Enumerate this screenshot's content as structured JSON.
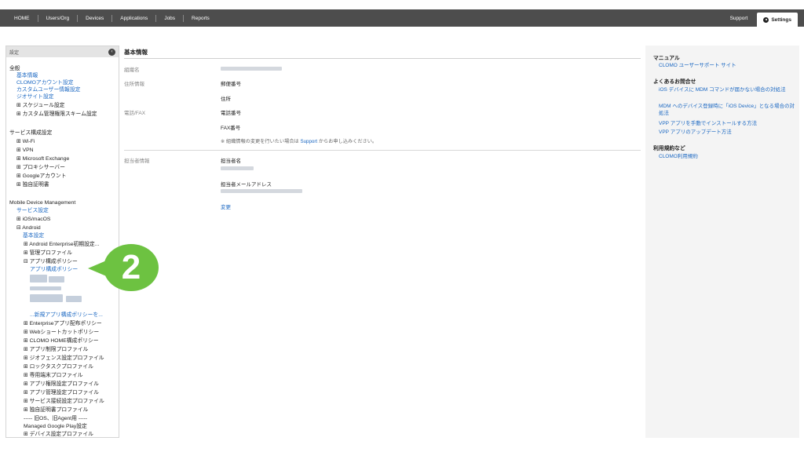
{
  "topnav": {
    "items": [
      "HOME",
      "Users/Org",
      "Devices",
      "Applications",
      "Jobs",
      "Reports"
    ],
    "support": "Support",
    "settings": "Settings"
  },
  "sidebar": {
    "header": "設定",
    "general_heading": "全般",
    "general_links": [
      "基本情報",
      "CLOMOアカウント設定",
      "カスタムユーザー情報設定",
      "ジオサイト設定"
    ],
    "general_trees": [
      "⊞ スケジュール設定",
      "⊞ カスタム管理権限スキーム設定"
    ],
    "service_heading": "サービス構成設定",
    "service_items": [
      "⊞ Wi-Fi",
      "⊞ VPN",
      "⊞ Microsoft Exchange",
      "⊞ プロキシサーバー",
      "⊞ Googleアカウント",
      "⊞ 独自証明書"
    ],
    "mdm_heading": "Mobile Device Management",
    "mdm_service_link": "サービス設定",
    "mdm_ios": "⊞ iOS/macOS",
    "mdm_android": "⊟ Android",
    "android_basic_link": "基本設定",
    "android_enterprise": "⊞ Android Enterprise初期設定...",
    "android_mgmt_profile": "⊞ 管理プロファイル",
    "app_config_tree": "⊟ アプリ構成ポリシー",
    "app_config_link": "アプリ構成ポリシー",
    "new_policy_link": "...新規アプリ構成ポリシーを...",
    "android_more": [
      "⊞ Enterpriseアプリ配布ポリシー",
      "⊞ Webショートカットポリシー",
      "⊞ CLOMO HOME構成ポリシー",
      "⊞ アプリ制限プロファイル",
      "⊞ ジオフェンス設定プロファイル",
      "⊞ ロックタスクプロファイル",
      "⊞ 専用端末プロファイル",
      "⊞ アプリ権限設定プロファイル",
      "⊞ アプリ管理設定プロファイル",
      "⊞ サービス接続設定プロファイル",
      "⊞ 独自証明書プロファイル"
    ],
    "legacy_separator": "----- 旧OS、旧Agent用 -----",
    "managed_play": "Managed Google Play設定",
    "device_profile": "⊞ デバイス設定プロファイル"
  },
  "main": {
    "title": "基本情報",
    "org_name_label": "組織名",
    "address_label": "住所情報",
    "postal_label": "郵便番号",
    "address_field_label": "住所",
    "phone_fax_label": "電話/FAX",
    "phone_label": "電話番号",
    "fax_label": "FAX番号",
    "note_prefix": "※ 組織情報の変更を行いたい場合は ",
    "note_link": "Support",
    "note_suffix": " からお申し込みください。",
    "contact_label": "担当者情報",
    "contact_name_label": "担当者名",
    "contact_email_label": "担当者メールアドレス",
    "change_link": "変更"
  },
  "rightpanel": {
    "manual_heading": "マニュアル",
    "manual_link": "CLOMO ユーザーサポート サイト",
    "faq_heading": "よくあるお問合せ",
    "faq_links": [
      "iOS デバイスに MDM コマンドが届かない場合の対処法",
      "MDM へのデバイス登録時に「iOS Device」となる場合の対処法",
      "VPP アプリを手動でインストールする方法",
      "VPP アプリのアップデート方法"
    ],
    "terms_heading": "利用規約など",
    "terms_link": "CLOMO利用規約"
  },
  "callout": {
    "number": "2"
  }
}
